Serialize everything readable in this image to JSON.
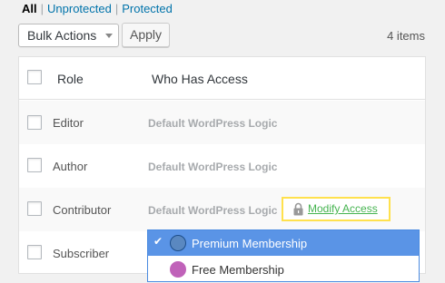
{
  "filters": {
    "all": "All",
    "unprotected": "Unprotected",
    "protected": "Protected",
    "separator": "|"
  },
  "bulk_actions": {
    "selected": "Bulk Actions",
    "apply_label": "Apply",
    "items_count": "4 items"
  },
  "table": {
    "headers": {
      "role": "Role",
      "access": "Who Has Access"
    },
    "rows": [
      {
        "role": "Editor",
        "access": "Default WordPress Logic"
      },
      {
        "role": "Author",
        "access": "Default WordPress Logic"
      },
      {
        "role": "Contributor",
        "access": "Default WordPress Logic"
      },
      {
        "role": "Subscriber",
        "access": ""
      }
    ]
  },
  "modify_access": {
    "label": "Modify Access"
  },
  "membership_dropdown": {
    "options": [
      {
        "label": "Premium Membership",
        "color": "#5a88c0",
        "selected": true
      },
      {
        "label": "Free Membership",
        "color": "#c062b9",
        "selected": false
      }
    ]
  },
  "colors": {
    "link": "#0073aa",
    "accent_select": "#5a94e6",
    "modify_link": "#46b450",
    "highlight_border": "#ffe14d"
  }
}
